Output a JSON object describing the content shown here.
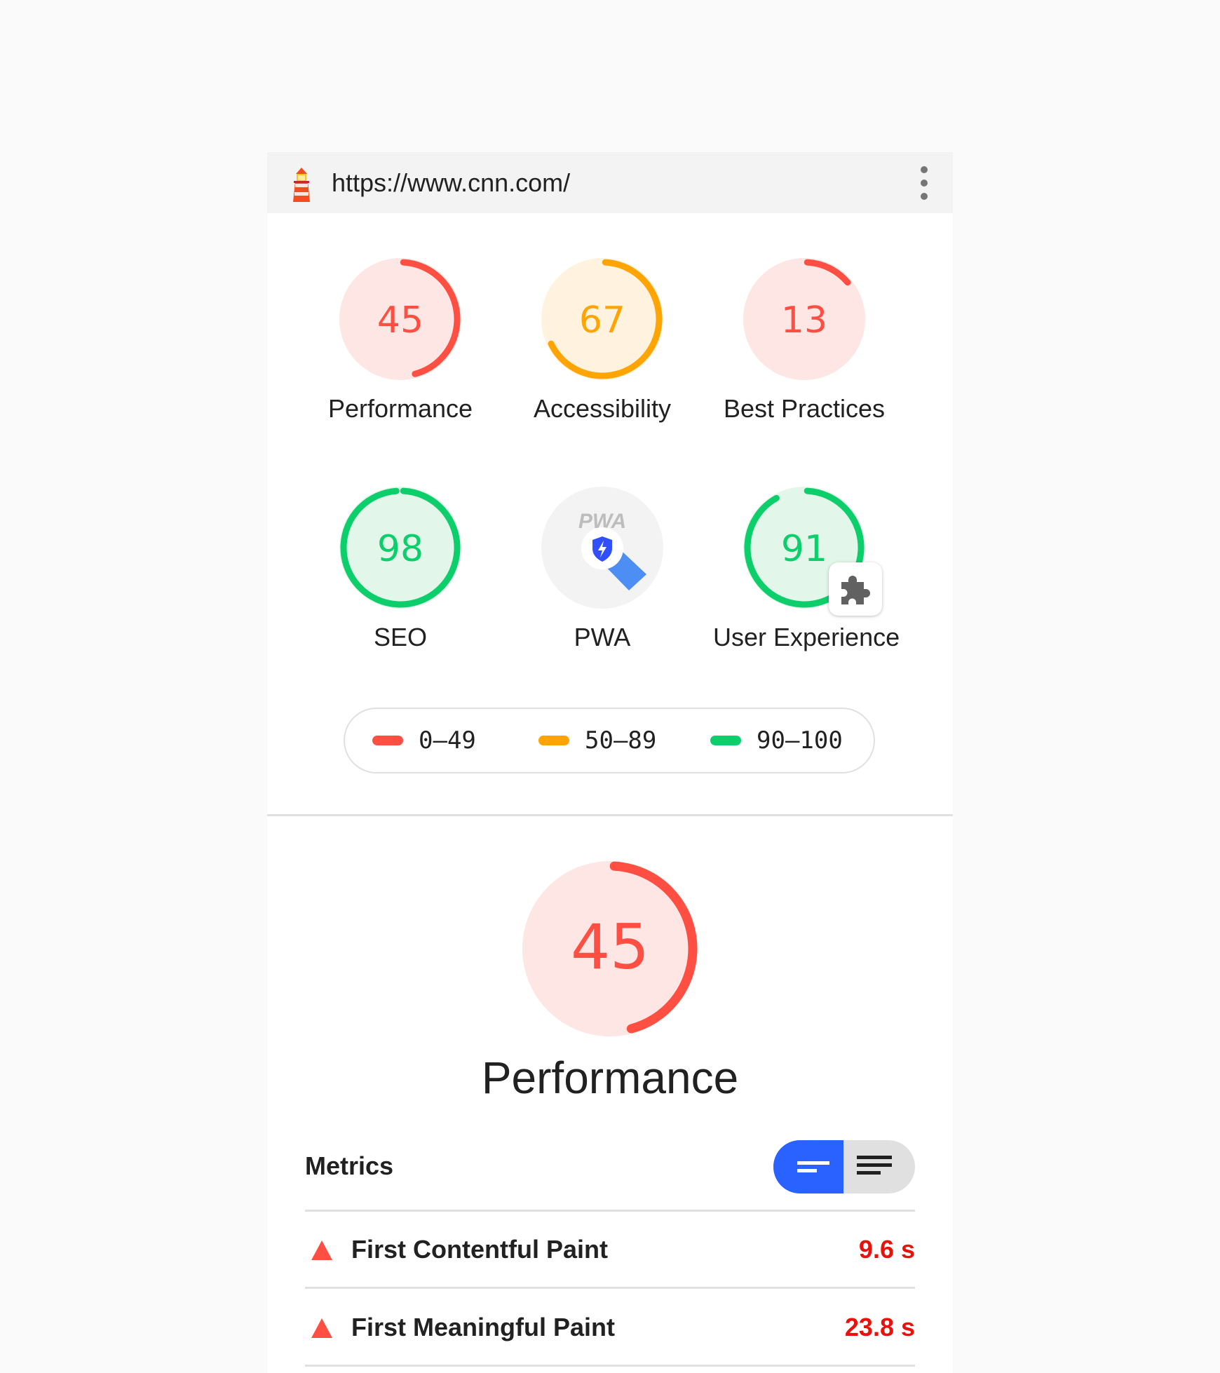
{
  "header": {
    "url": "https://www.cnn.com/",
    "logo_icon": "lighthouse-icon",
    "menu_icon": "kebab-menu-icon"
  },
  "colors": {
    "fail": "#ff4e42",
    "average": "#ffa400",
    "pass": "#0cce6b",
    "fail_bg": "#fde6e4",
    "average_bg": "#fff3df",
    "pass_bg": "#e2f7ea",
    "accent": "#2962ff"
  },
  "gauges": [
    {
      "id": "performance",
      "score": "45",
      "label": "Performance",
      "value": 45,
      "rating": "fail"
    },
    {
      "id": "accessibility",
      "score": "67",
      "label": "Accessibility",
      "value": 67,
      "rating": "average"
    },
    {
      "id": "best-practices",
      "score": "13",
      "label": "Best Practices",
      "value": 13,
      "rating": "fail"
    },
    {
      "id": "seo",
      "score": "98",
      "label": "SEO",
      "value": 98,
      "rating": "pass"
    },
    {
      "id": "pwa",
      "score": "",
      "label": "PWA",
      "value": null,
      "rating": "pwa",
      "badge_text": "PWA",
      "badge_icon": "pwa-shield-icon"
    },
    {
      "id": "user-experience",
      "score": "91",
      "label": "User Experience",
      "value": 91,
      "rating": "pass",
      "badge_icon": "puzzle-piece-icon"
    }
  ],
  "legend": [
    {
      "range": "0–49",
      "rating": "fail"
    },
    {
      "range": "50–89",
      "rating": "average"
    },
    {
      "range": "90–100",
      "rating": "pass"
    }
  ],
  "performance_section": {
    "score": "45",
    "value": 45,
    "title": "Performance"
  },
  "metrics": {
    "title": "Metrics",
    "toggle": {
      "left_icon": "compact-view-icon",
      "right_icon": "expanded-view-icon",
      "selected": "left"
    },
    "rows": [
      {
        "name": "First Contentful Paint",
        "value": "9.6 s",
        "icon": "fail-triangle-icon"
      },
      {
        "name": "First Meaningful Paint",
        "value": "23.8 s",
        "icon": "fail-triangle-icon"
      }
    ]
  }
}
